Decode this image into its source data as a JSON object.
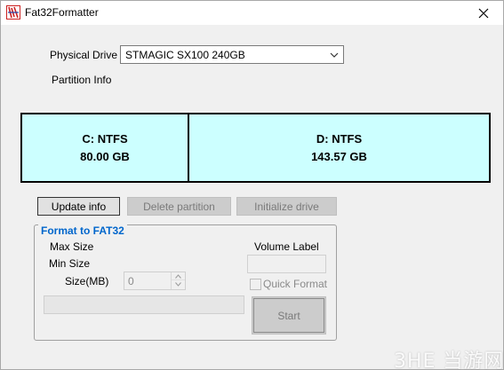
{
  "window": {
    "title": "Fat32Formatter",
    "icon": "fat32formatter-app-icon"
  },
  "drive": {
    "label": "Physical Drive",
    "selected": "STMAGIC SX100 240GB"
  },
  "partition_info_label": "Partition Info",
  "partitions": [
    {
      "name": "C: NTFS",
      "size": "80.00 GB"
    },
    {
      "name": "D: NTFS",
      "size": "143.57 GB"
    }
  ],
  "buttons": {
    "update_info": "Update info",
    "delete_partition": "Delete partition",
    "initialize_drive": "Initialize drive"
  },
  "format_group": {
    "title": "Format to FAT32",
    "max_size_label": "Max Size",
    "min_size_label": "Min Size",
    "size_label": "Size(MB)",
    "size_value": "0",
    "volume_label_label": "Volume Label",
    "volume_label_value": "",
    "quick_format_label": "Quick Format",
    "quick_format_checked": false,
    "start_label": "Start"
  },
  "watermark": "3HE 当游网",
  "colors": {
    "partition_fill": "#ccffff",
    "group_title": "#0066cc",
    "window_bg": "#f0f0f0"
  }
}
